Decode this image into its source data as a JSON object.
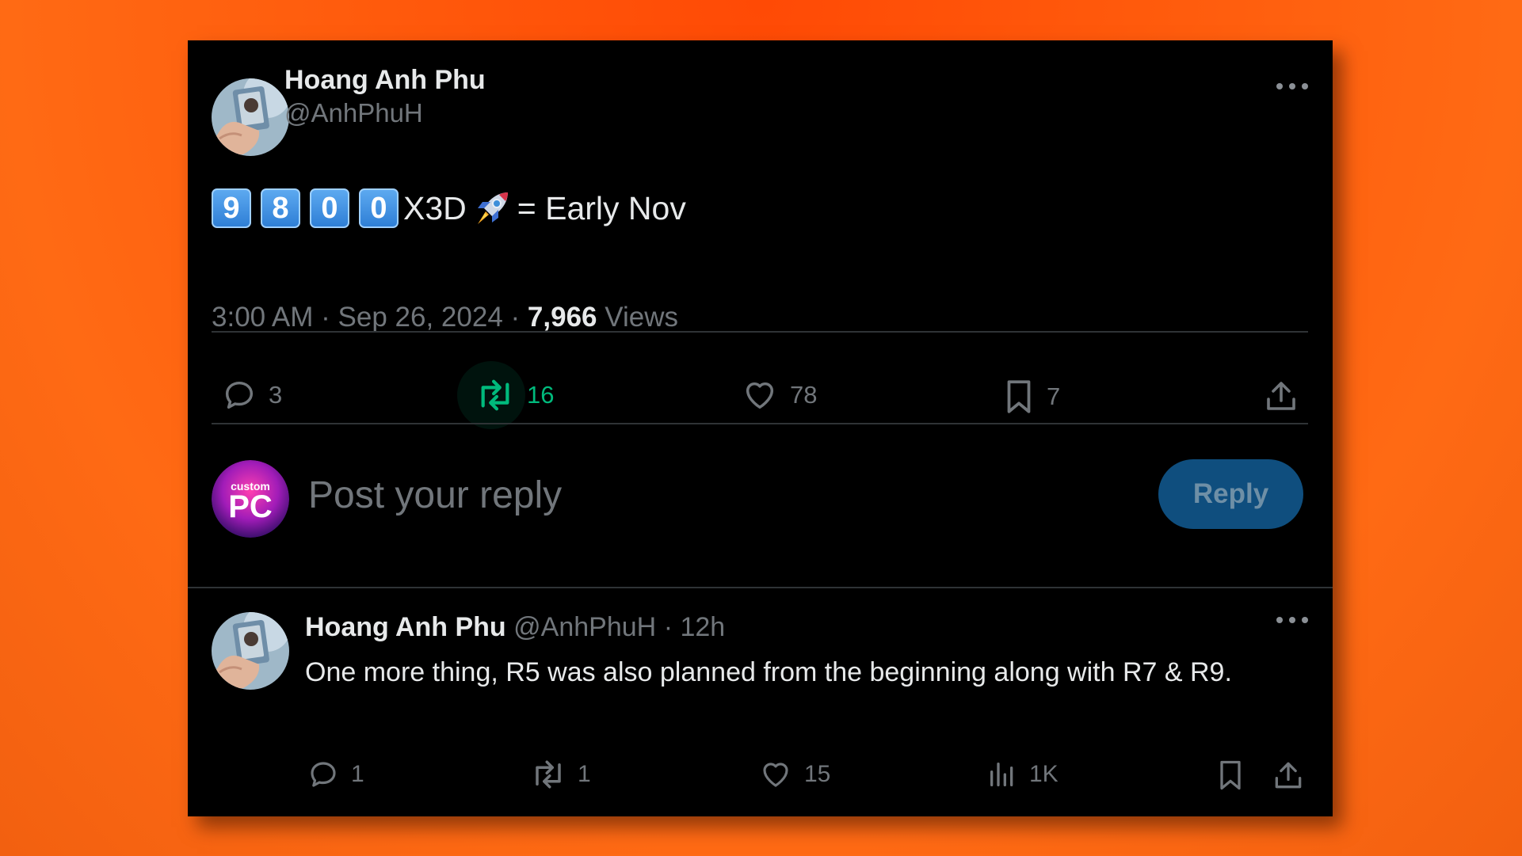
{
  "main_tweet": {
    "author_name": "Hoang Anh Phu",
    "author_handle": "@AnhPhuH",
    "text_keycaps": [
      "9",
      "8",
      "0",
      "0"
    ],
    "text_suffix": "X3D",
    "text_emoji": "rocket-emoji",
    "text_tail": "= Early Nov",
    "time": "3:00 AM",
    "separator": "·",
    "date": "Sep 26, 2024",
    "views_count": "7,966",
    "views_label": "Views",
    "replies": "3",
    "reposts": "16",
    "likes": "78",
    "bookmarks": "7"
  },
  "composer": {
    "avatar_logo_top": "custom",
    "avatar_logo_bottom": "PC",
    "placeholder": "Post your reply",
    "button_label": "Reply"
  },
  "reply_tweet": {
    "author_name": "Hoang Anh Phu",
    "author_handle": "@AnhPhuH",
    "separator": "·",
    "time_ago": "12h",
    "text": "One more thing, R5 was also planned from the beginning along with R7 & R9.",
    "replies": "1",
    "reposts": "1",
    "likes": "15",
    "views": "1K"
  },
  "colors": {
    "background": "#ff5a0c",
    "card": "#000000",
    "text_primary": "#e7e9ea",
    "text_muted": "#71767b",
    "repost_active": "#00ba7c",
    "reply_button": "#0f4e7e"
  },
  "icons": [
    "more-icon",
    "reply-icon",
    "repost-icon",
    "like-icon",
    "bookmark-icon",
    "share-icon",
    "views-icon"
  ]
}
